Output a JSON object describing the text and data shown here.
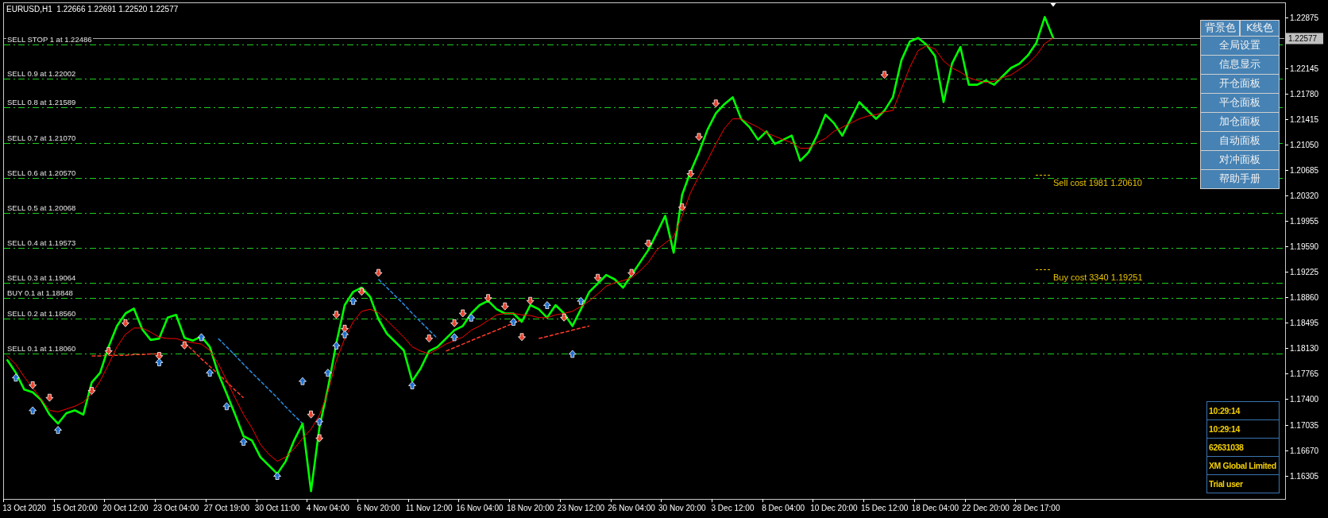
{
  "chart": {
    "chart_data": {
      "type": "line",
      "title": "EURUSD,H1  1.22666 1.22691 1.22520 1.22577",
      "categories": [
        null,
        null,
        "13 Oct 2020",
        null,
        null,
        null,
        null,
        null,
        "15 Oct 20:00",
        null,
        null,
        null,
        null,
        null,
        "20 Oct 12:00",
        null,
        null,
        null,
        null,
        null,
        "23 Oct 04:00",
        null,
        null,
        null,
        null,
        null,
        "27 Oct 19:00",
        null,
        null,
        null,
        null,
        null,
        "30 Oct 11:00",
        null,
        null,
        null,
        null,
        null,
        "4 Nov 04:00",
        null,
        null,
        null,
        null,
        null,
        "6 Nov 20:00",
        null,
        null,
        null,
        null,
        null,
        "11 Nov 12:00",
        null,
        null,
        null,
        null,
        null,
        "16 Nov 04:00",
        null,
        null,
        null,
        null,
        null,
        "18 Nov 20:00",
        null,
        null,
        null,
        null,
        null,
        "23 Nov 12:00",
        null,
        null,
        null,
        null,
        null,
        "26 Nov 04:00",
        null,
        null,
        null,
        null,
        null,
        "30 Nov 20:00",
        null,
        null,
        null,
        null,
        null,
        "3 Dec 12:00",
        null,
        null,
        null,
        null,
        null,
        "8 Dec 04:00",
        null,
        null,
        null,
        null,
        null,
        "10 Dec 20:00",
        null,
        null,
        null,
        null,
        null,
        "15 Dec 12:00",
        null,
        null,
        null,
        null,
        null,
        "18 Dec 04:00",
        null,
        null,
        null,
        null,
        null,
        "22 Dec 20:00",
        null,
        null,
        null,
        null,
        null,
        "28 Dec 17:00",
        null,
        null,
        null,
        null,
        null,
        null,
        null,
        null,
        null,
        null,
        null,
        null,
        null,
        null,
        null,
        null,
        null,
        null,
        null,
        null,
        null,
        null,
        null,
        null,
        null,
        null,
        null,
        null,
        null
      ],
      "series": [
        {
          "color": "#00ff00",
          "values": [
            1.1796,
            1.1778,
            1.1754,
            1.175,
            1.1739,
            1.1718,
            1.1705,
            1.172,
            1.1724,
            1.1718,
            1.1764,
            1.1778,
            1.1815,
            1.1845,
            1.1863,
            1.187,
            1.184,
            1.1825,
            1.1827,
            1.1857,
            1.1861,
            1.1828,
            1.1824,
            1.183,
            1.1815,
            1.1777,
            1.1748,
            1.1718,
            1.1687,
            1.1681,
            1.1657,
            1.1645,
            1.1633,
            1.1651,
            1.1681,
            1.1705,
            1.1608,
            1.17,
            1.1755,
            1.182,
            1.1875,
            1.1894,
            1.19,
            1.1887,
            1.1855,
            1.1834,
            1.1822,
            1.181,
            1.1766,
            1.1784,
            1.1809,
            1.1815,
            1.1827,
            1.1839,
            1.1845,
            1.1863,
            1.1875,
            1.1881,
            1.1869,
            1.1863,
            1.1863,
            1.1851,
            1.1875,
            1.1869,
            1.1857,
            1.1875,
            1.1863,
            1.1845,
            1.1869,
            1.1894,
            1.1906,
            1.1918,
            1.1912,
            1.19,
            1.1918,
            1.1936,
            1.1954,
            1.1978,
            1.2003,
            1.195,
            1.2033,
            1.2066,
            1.2094,
            1.2126,
            1.215,
            1.2163,
            1.2173,
            1.2142,
            1.213,
            1.2112,
            1.2124,
            1.2106,
            1.2112,
            1.2118,
            1.2082,
            1.2094,
            1.2118,
            1.2148,
            1.2136,
            1.2118,
            1.2142,
            1.2166,
            1.2154,
            1.2142,
            1.2154,
            1.2173,
            1.2226,
            1.2253,
            1.2258,
            1.2248,
            1.2232,
            1.2166,
            1.2221,
            1.2245,
            1.2191,
            1.2191,
            1.2197,
            1.2191,
            1.2203,
            1.2215,
            1.2221,
            1.2233,
            1.2251,
            1.2288,
            1.2258,
            null,
            null,
            null,
            null,
            null,
            null,
            null,
            null,
            null,
            null,
            null,
            null,
            null,
            null,
            null,
            null,
            null,
            null,
            null,
            null,
            null,
            null,
            null,
            null,
            null,
            null,
            null
          ]
        },
        {
          "color": "#ff0000",
          "values": [
            1.1802,
            1.179,
            1.1772,
            1.1756,
            1.174,
            1.1724,
            1.1722,
            1.1726,
            1.173,
            1.1736,
            1.1748,
            1.1766,
            1.179,
            1.1815,
            1.1833,
            1.1842,
            1.1842,
            1.1836,
            1.1829,
            1.1827,
            1.1827,
            1.1823,
            1.1821,
            1.1819,
            1.181,
            1.1791,
            1.1767,
            1.1742,
            1.1718,
            1.1699,
            1.1675,
            1.1661,
            1.1651,
            1.1657,
            1.1669,
            1.1684,
            1.1697,
            1.1717,
            1.175,
            1.1795,
            1.1827,
            1.1851,
            1.1866,
            1.1869,
            1.1864,
            1.1853,
            1.1841,
            1.1829,
            1.1815,
            1.1809,
            1.1805,
            1.1812,
            1.1819,
            1.1824,
            1.1829,
            1.1839,
            1.1845,
            1.1853,
            1.1861,
            1.1863,
            1.1863,
            1.1861,
            1.186,
            1.1857,
            1.1857,
            1.1861,
            1.1863,
            1.1866,
            1.1873,
            1.1881,
            1.1891,
            1.1902,
            1.1907,
            1.191,
            1.1914,
            1.1924,
            1.1936,
            1.1954,
            1.1964,
            1.1973,
            1.2003,
            1.2036,
            1.206,
            1.2082,
            1.2106,
            1.2128,
            1.2142,
            1.2142,
            1.2136,
            1.213,
            1.2122,
            1.2117,
            1.2112,
            1.2108,
            1.21,
            1.21,
            1.2108,
            1.2114,
            1.2124,
            1.213,
            1.2136,
            1.2142,
            1.2146,
            1.2148,
            1.2152,
            1.2154,
            1.2185,
            1.2216,
            1.224,
            1.2247,
            1.2242,
            1.2225,
            1.2215,
            1.2209,
            1.2201,
            1.2197,
            1.2194,
            1.2196,
            1.2201,
            1.2205,
            1.2213,
            1.2221,
            1.2233,
            1.225,
            1.2258,
            null,
            null,
            null,
            null,
            null,
            null,
            null,
            null,
            null,
            null,
            null,
            null,
            null,
            null,
            null,
            null,
            null,
            null,
            null,
            null,
            null,
            null,
            null,
            null,
            null,
            null,
            null
          ]
        },
        {
          "type": "scatter",
          "color": "#e8412c",
          "marker": "v",
          "values": [
            null,
            null,
            null,
            1.176,
            null,
            1.1742,
            null,
            null,
            null,
            null,
            1.1752,
            null,
            1.1809,
            null,
            1.1849,
            null,
            null,
            null,
            1.1802,
            null,
            null,
            1.1817,
            null,
            null,
            null,
            null,
            null,
            null,
            null,
            null,
            null,
            null,
            null,
            null,
            null,
            null,
            1.1718,
            null,
            null,
            1.1861,
            null,
            null,
            1.1894,
            null,
            1.1921,
            null,
            null,
            null,
            null,
            null,
            1.1827,
            null,
            null,
            1.1849,
            null,
            null,
            null,
            1.1885,
            null,
            1.1873,
            null,
            1.1829,
            null,
            null,
            null,
            null,
            1.1857,
            null,
            null,
            null,
            1.1914,
            null,
            null,
            null,
            1.1921,
            null,
            1.1963,
            null,
            null,
            null,
            1.2015,
            null,
            1.2116,
            null,
            1.2164,
            null,
            null,
            null,
            null,
            null,
            null,
            null,
            null,
            null,
            null,
            null,
            null,
            null,
            null,
            null,
            null,
            null,
            null,
            null,
            1.2205,
            null,
            null,
            null,
            null,
            null,
            null,
            null,
            null,
            null,
            null,
            null,
            null,
            null,
            null,
            null,
            null,
            null,
            null,
            null,
            null,
            null,
            null,
            null,
            null,
            null,
            null,
            null,
            null,
            null,
            null,
            null,
            null,
            null,
            null,
            null,
            null,
            null,
            null,
            null,
            null,
            null,
            null,
            null,
            null,
            null,
            null,
            null
          ]
        },
        {
          "type": "scatter",
          "color": "#1f6fd0",
          "marker": "^",
          "values": [
            null,
            1.1771,
            null,
            1.1724,
            null,
            null,
            1.1696,
            null,
            null,
            null,
            null,
            null,
            null,
            null,
            null,
            null,
            null,
            null,
            1.1793,
            null,
            null,
            null,
            null,
            1.1829,
            null,
            null,
            1.173,
            null,
            1.1679,
            null,
            null,
            null,
            1.163,
            null,
            null,
            1.1766,
            null,
            1.1708,
            null,
            1.1817,
            null,
            1.1881,
            null,
            null,
            null,
            null,
            null,
            null,
            1.176,
            null,
            null,
            null,
            null,
            1.1829,
            null,
            1.1857,
            null,
            null,
            null,
            null,
            1.1851,
            null,
            null,
            null,
            1.1875,
            null,
            null,
            1.1805,
            null,
            null,
            null,
            null,
            null,
            null,
            null,
            null,
            null,
            null,
            null,
            null,
            null,
            null,
            null,
            null,
            null,
            null,
            null,
            null,
            null,
            null,
            null,
            null,
            null,
            null,
            null,
            null,
            null,
            null,
            null,
            null,
            null,
            null,
            null,
            null,
            null,
            null,
            null,
            null,
            null,
            null,
            null,
            null,
            null,
            null,
            null,
            null,
            null,
            null,
            null,
            null,
            null,
            null,
            null,
            null,
            null,
            null,
            null,
            null,
            null,
            null,
            null,
            null,
            null,
            null,
            null,
            null,
            null,
            null,
            null,
            null,
            null,
            null,
            null,
            null,
            null,
            null,
            null,
            null,
            null,
            null,
            null,
            null
          ]
        },
        {
          "color": "#ff3a2a",
          "line_style": "dashed",
          "values": [
            null,
            null,
            null,
            null,
            null,
            null,
            null,
            null,
            null,
            null,
            1.1802,
            1.1802,
            1.1803,
            1.1803,
            1.1803,
            1.1804,
            1.1804,
            1.1805,
            1.1805,
            null,
            null,
            1.1821,
            1.181,
            1.1798,
            1.1787,
            1.1776,
            1.1765,
            1.1753,
            1.1742,
            null,
            null,
            null,
            null,
            null,
            null,
            null,
            null,
            null,
            null,
            null,
            null,
            null,
            null,
            null,
            null,
            null,
            null,
            null,
            null,
            null,
            null,
            null,
            1.1809,
            1.1814,
            1.1819,
            1.1824,
            1.1829,
            1.1834,
            1.1839,
            1.1844,
            1.1849,
            1.1854,
            null,
            1.1827,
            1.183,
            1.1833,
            1.1836,
            1.1839,
            1.1842,
            1.1845,
            null,
            null,
            null,
            null,
            null,
            null,
            null,
            null,
            null,
            null,
            null,
            null,
            null,
            null,
            null,
            null,
            null,
            null,
            null,
            null,
            null,
            null,
            null,
            null,
            null,
            null,
            null,
            null,
            null,
            null,
            null,
            null,
            null,
            null,
            null,
            null,
            null,
            null,
            null,
            null,
            null,
            null,
            null,
            null,
            null,
            null,
            null,
            null,
            null,
            null,
            null,
            null,
            null,
            null,
            null,
            null,
            null,
            null,
            null,
            null,
            null,
            null,
            null,
            null,
            null,
            null,
            null,
            null,
            null,
            null,
            null,
            null,
            null,
            null,
            null,
            null,
            null,
            null,
            null,
            null,
            null,
            null
          ]
        },
        {
          "color": "#2a8ce0",
          "line_style": "dashed",
          "values": [
            null,
            null,
            null,
            null,
            null,
            null,
            null,
            null,
            null,
            null,
            null,
            null,
            null,
            null,
            null,
            null,
            null,
            null,
            null,
            null,
            null,
            null,
            null,
            null,
            null,
            1.1827,
            1.1815,
            1.1803,
            1.179,
            1.1778,
            1.1766,
            1.1754,
            1.1742,
            1.1729,
            1.1717,
            1.1705,
            null,
            null,
            null,
            null,
            null,
            null,
            null,
            null,
            1.1912,
            1.19,
            1.1888,
            1.1876,
            1.1863,
            1.1851,
            1.1839,
            1.1827,
            null,
            null,
            null,
            null,
            null,
            null,
            null,
            null,
            null,
            null,
            null,
            null,
            null,
            null,
            null,
            null,
            null,
            null,
            null,
            null,
            null,
            null,
            null,
            null,
            null,
            null,
            null,
            null,
            null,
            null,
            null,
            null,
            null,
            null,
            null,
            null,
            null,
            null,
            null,
            null,
            null,
            null,
            null,
            null,
            null,
            null,
            null,
            null,
            null,
            null,
            null,
            null,
            null,
            null,
            null,
            null,
            null,
            null,
            null,
            null,
            null,
            null,
            null,
            null,
            null,
            null,
            null,
            null,
            null,
            null,
            null,
            null,
            null,
            null,
            null,
            null,
            null,
            null,
            null,
            null,
            null,
            null,
            null,
            null,
            null,
            null,
            null,
            null,
            null,
            null,
            null,
            null,
            null,
            null,
            null,
            null,
            null,
            null,
            null,
            null
          ]
        },
        {
          "type": "scatter",
          "color": "#e8412c",
          "marker": "v",
          "values": [
            null,
            null,
            null,
            null,
            null,
            null,
            null,
            null,
            null,
            null,
            null,
            null,
            null,
            null,
            null,
            null,
            null,
            null,
            null,
            null,
            null,
            null,
            null,
            null,
            null,
            null,
            null,
            null,
            null,
            null,
            null,
            null,
            null,
            null,
            null,
            null,
            null,
            1.1684,
            null,
            null,
            1.1841,
            null,
            null,
            null,
            null,
            null,
            null,
            null,
            null,
            null,
            null,
            null,
            null,
            null,
            1.1863,
            null,
            null,
            null,
            null,
            null,
            null,
            null,
            1.1881,
            null,
            null,
            null,
            null,
            null,
            null,
            null,
            null,
            null,
            null,
            null,
            null,
            null,
            null,
            null,
            null,
            null,
            null,
            1.2063,
            null,
            null,
            null,
            null,
            null,
            null,
            null,
            null,
            null,
            null,
            null,
            null,
            null,
            null,
            null,
            null,
            null,
            null,
            null,
            null,
            null,
            null,
            null,
            null,
            null,
            null,
            null,
            null,
            null,
            null,
            null,
            null,
            null,
            null,
            null,
            null,
            null,
            null,
            null,
            null,
            null,
            null,
            null,
            null,
            null,
            null,
            null,
            null,
            null,
            null,
            null,
            null,
            null,
            null,
            null,
            null,
            null,
            null,
            null,
            null,
            null,
            null,
            null,
            null,
            null,
            null,
            null,
            null,
            null,
            null
          ]
        },
        {
          "type": "scatter",
          "color": "#1f6fd0",
          "marker": "^",
          "values": [
            null,
            null,
            null,
            null,
            null,
            null,
            null,
            null,
            null,
            null,
            null,
            null,
            null,
            null,
            null,
            null,
            null,
            null,
            null,
            null,
            null,
            null,
            null,
            null,
            1.1778,
            null,
            null,
            null,
            null,
            null,
            null,
            null,
            null,
            null,
            null,
            null,
            null,
            null,
            1.1778,
            null,
            1.1833,
            null,
            null,
            null,
            null,
            null,
            null,
            null,
            null,
            null,
            null,
            null,
            null,
            null,
            null,
            null,
            null,
            null,
            null,
            null,
            null,
            null,
            null,
            null,
            null,
            null,
            null,
            null,
            1.1881,
            null,
            null,
            null,
            null,
            null,
            null,
            null,
            null,
            null,
            null,
            null,
            null,
            null,
            null,
            null,
            null,
            null,
            null,
            null,
            null,
            null,
            null,
            null,
            null,
            null,
            null,
            null,
            null,
            null,
            null,
            null,
            null,
            null,
            null,
            null,
            null,
            null,
            null,
            null,
            null,
            null,
            null,
            null,
            null,
            null,
            null,
            null,
            null,
            null,
            null,
            null,
            null,
            null,
            null,
            null,
            null,
            null,
            null,
            null,
            null,
            null,
            null,
            null,
            null,
            null,
            null,
            null,
            null,
            null,
            null,
            null,
            null,
            null,
            null,
            null,
            null,
            null,
            null,
            null,
            null,
            null,
            null,
            null
          ]
        }
      ],
      "ylim": [
        1.1597,
        1.2309
      ],
      "yticks": [
        {
          "value": 1.22875,
          "label": "1.22875"
        },
        {
          "value": 1.22145,
          "label": "1.22145"
        },
        {
          "value": 1.2178,
          "label": "1.21780"
        },
        {
          "value": 1.21415,
          "label": "1.21415"
        },
        {
          "value": 1.2105,
          "label": "1.21050"
        },
        {
          "value": 1.20685,
          "label": "1.20685"
        },
        {
          "value": 1.2032,
          "label": "1.20320"
        },
        {
          "value": 1.19955,
          "label": "1.19955"
        },
        {
          "value": 1.1959,
          "label": "1.19590"
        },
        {
          "value": 1.19225,
          "label": "1.19225"
        },
        {
          "value": 1.1886,
          "label": "1.18860"
        },
        {
          "value": 1.18495,
          "label": "1.18495"
        },
        {
          "value": 1.1813,
          "label": "1.18130"
        },
        {
          "value": 1.17765,
          "label": "1.17765"
        },
        {
          "value": 1.174,
          "label": "1.17400"
        },
        {
          "value": 1.17035,
          "label": "1.17035"
        },
        {
          "value": 1.1667,
          "label": "1.16670"
        },
        {
          "value": 1.16305,
          "label": "1.16305"
        }
      ],
      "ref_lines": [
        {
          "axis": "y",
          "value": 1.22577,
          "label": "1.22577",
          "color": "#a8a8a8",
          "line_style": "solid"
        },
        {
          "axis": "y",
          "value": 1.22486,
          "label": "SELL STOP 1 at 1.22486",
          "color": "#22cc22",
          "line_style": "dashdot"
        },
        {
          "axis": "y",
          "value": 1.22002,
          "label": "SELL 0.9 at 1.22002",
          "color": "#22cc22",
          "line_style": "dashdot"
        },
        {
          "axis": "y",
          "value": 1.21589,
          "label": "SELL 0.8 at 1.21589",
          "color": "#22cc22",
          "line_style": "dashdot"
        },
        {
          "axis": "y",
          "value": 1.2107,
          "label": "SELL 0.7 at 1.21070",
          "color": "#22cc22",
          "line_style": "dashdot"
        },
        {
          "axis": "y",
          "value": 1.2057,
          "label": "SELL 0.6 at 1.20570",
          "color": "#22cc22",
          "line_style": "dashdot"
        },
        {
          "axis": "y",
          "value": 1.20068,
          "label": "SELL 0.5 at 1.20068",
          "color": "#22cc22",
          "line_style": "dashdot"
        },
        {
          "axis": "y",
          "value": 1.19573,
          "label": "SELL 0.4 at 1.19573",
          "color": "#22cc22",
          "line_style": "dashdot"
        },
        {
          "axis": "y",
          "value": 1.19064,
          "label": "SELL 0.3 at 1.19064",
          "color": "#22cc22",
          "line_style": "dashdot"
        },
        {
          "axis": "y",
          "value": 1.18848,
          "label": "BUY 0.1 at 1.18848",
          "color": "#22cc22",
          "line_style": "dashdot"
        },
        {
          "axis": "y",
          "value": 1.1856,
          "label": "SELL 0.2 at 1.18560",
          "color": "#22cc22",
          "line_style": "dashdot"
        },
        {
          "axis": "y",
          "value": 1.1806,
          "label": "SELL 0.1 at 1.18060",
          "color": "#22cc22",
          "line_style": "dashdot"
        }
      ],
      "annotations": [
        "Sell cost 1981 1.20610",
        "Buy cost 3340 1.19251"
      ]
    }
  },
  "panel": {
    "color_buttons": [
      "背景色",
      "K线色"
    ],
    "buttons": [
      "全局设置",
      "信息显示",
      "开仓面板",
      "平仓面板",
      "加仓面板",
      "自动面板",
      "对冲面板",
      "帮助手册"
    ]
  },
  "info_box": {
    "rows": [
      "10:29:14",
      "10:29:14",
      "62631038",
      "XM Global Limited",
      "Trial user"
    ]
  }
}
